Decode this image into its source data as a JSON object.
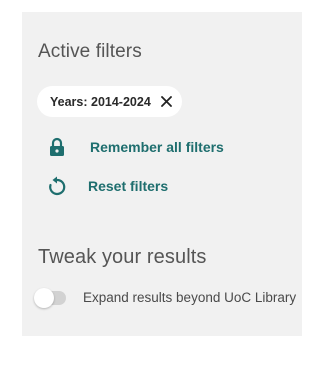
{
  "active_filters": {
    "heading": "Active filters",
    "chips": [
      {
        "label": "Years: 2014-2024",
        "remove_icon": "close-icon"
      }
    ]
  },
  "actions": {
    "remember": {
      "label": "Remember all filters",
      "icon": "lock-icon"
    },
    "reset": {
      "label": "Reset filters",
      "icon": "reset-icon"
    }
  },
  "tweak": {
    "heading": "Tweak your results",
    "expand_toggle": {
      "label": "Expand results beyond UoC Library",
      "checked": false
    }
  },
  "colors": {
    "panel_background": "#f1f1f1",
    "accent": "#1e6e6e",
    "heading_text": "#555555",
    "toggle_track": "#d2d2d2"
  }
}
